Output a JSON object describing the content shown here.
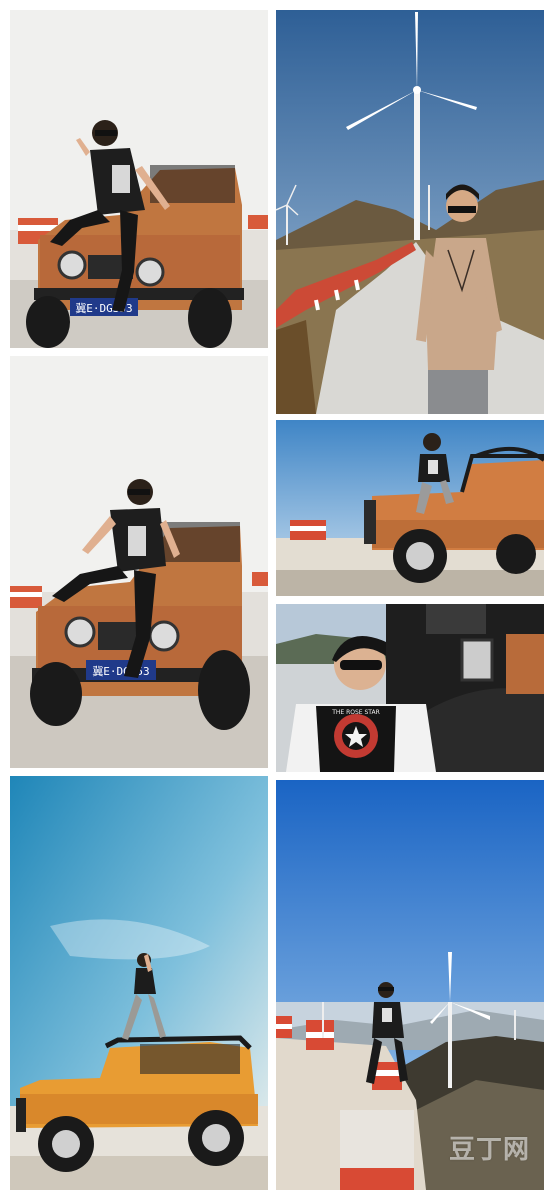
{
  "photos": {
    "p1": {
      "plate": "冀E·DG353"
    },
    "p3": {
      "plate": "冀E·DG353"
    },
    "p6": {
      "shirt_text": "THE ROSE STAR"
    },
    "p8": {
      "watermark": "豆丁网"
    }
  }
}
